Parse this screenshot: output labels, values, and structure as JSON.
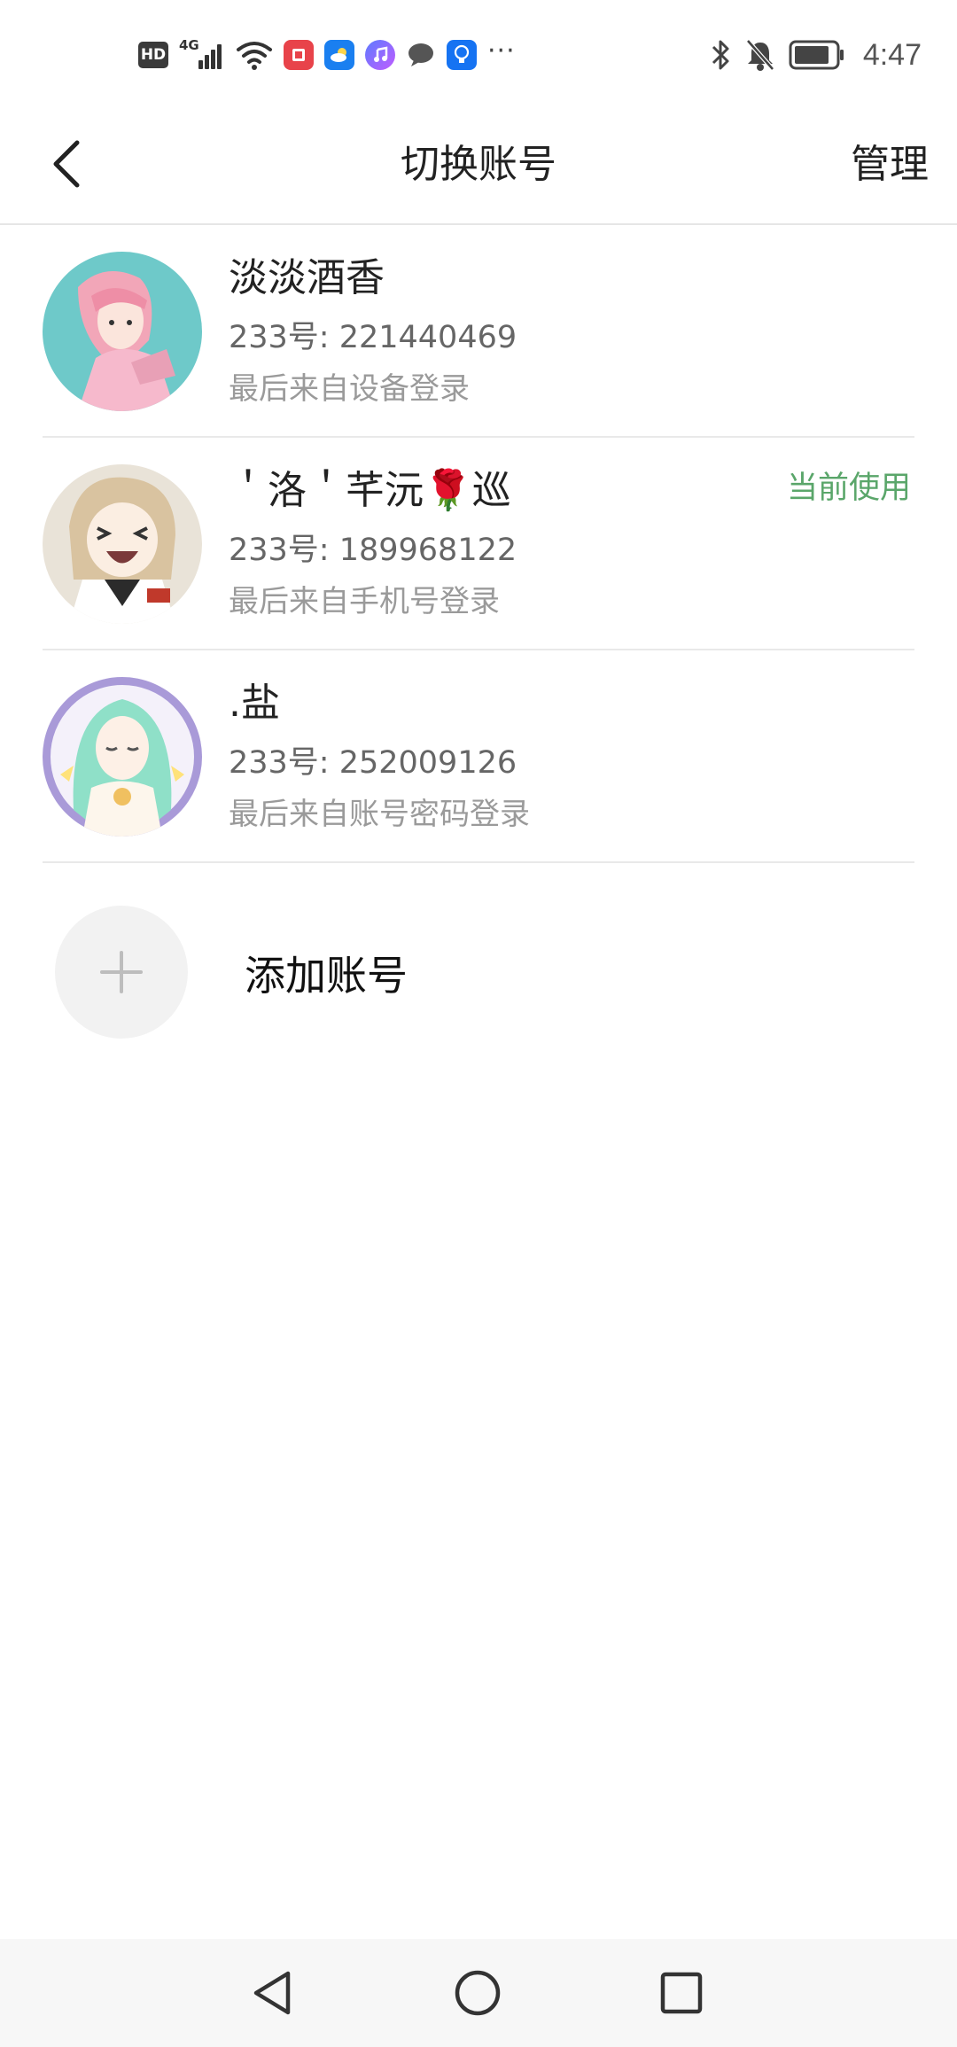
{
  "status_bar": {
    "hd_label": "HD",
    "network_type": "4G",
    "more": "···",
    "time": "4:47",
    "icons": [
      "hd-icon",
      "signal-icon",
      "wifi-icon",
      "red-app-icon",
      "weather-app-icon",
      "music-app-icon",
      "chat-app-icon",
      "bulb-app-icon",
      "bluetooth-icon",
      "mute-bell-icon",
      "battery-icon"
    ]
  },
  "header": {
    "title": "切换账号",
    "manage_label": "管理",
    "back_icon": "chevron-left-icon"
  },
  "accounts": [
    {
      "name": "淡淡酒香",
      "id_text": "233号: 221440469",
      "source": "最后来自设备登录",
      "current_label": "",
      "avatar": "pink-hair-girl-avatar"
    },
    {
      "name": "＇洛＇芊沅🌹巡",
      "id_text": "233号: 189968122",
      "source": "最后来自手机号登录",
      "current_label": "当前使用",
      "avatar": "laughing-girl-avatar"
    },
    {
      "name": ".盐",
      "id_text": "233号: 252009126",
      "source": "最后来自账号密码登录",
      "current_label": "",
      "avatar": "green-hair-girl-avatar"
    }
  ],
  "add_account": {
    "label": "添加账号",
    "icon": "plus-icon"
  },
  "nav": {
    "back_icon": "triangle-back-icon",
    "home_icon": "circle-home-icon",
    "recents_icon": "square-recents-icon"
  },
  "colors": {
    "current_badge": "#5aa66a",
    "divider": "#e9e9e9",
    "add_circle": "#f2f2f2"
  }
}
